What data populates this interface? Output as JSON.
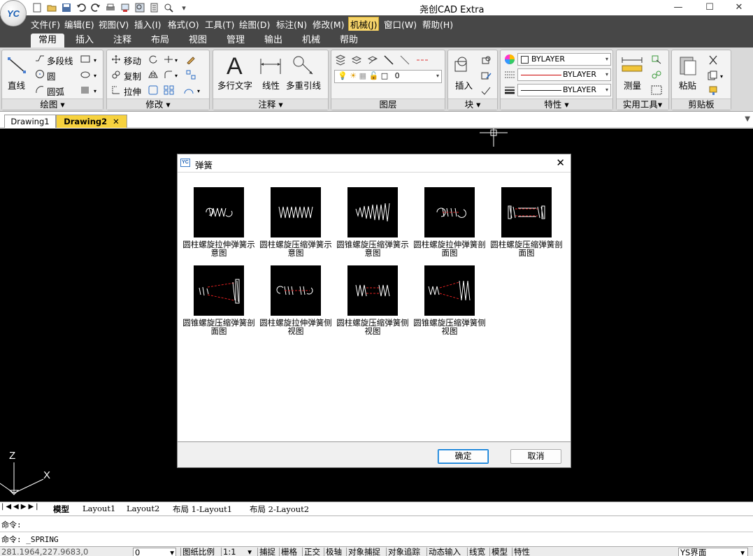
{
  "titlebar": {
    "logo_text": "YC",
    "app_title": "尧创CAD Extra",
    "qat_icons": [
      "new-icon",
      "open-icon",
      "save-icon",
      "undo-icon",
      "redo-icon",
      "print-icon",
      "plot-icon",
      "zoom-icon",
      "properties-icon",
      "find-icon",
      "customize-qat-icon"
    ],
    "window_controls": [
      "—",
      "☐",
      "✕"
    ]
  },
  "menubar": [
    {
      "label": "文件(F)"
    },
    {
      "label": "编辑(E)"
    },
    {
      "label": "视图(V)"
    },
    {
      "label": "插入(I)"
    },
    {
      "label": "格式(O)"
    },
    {
      "label": "工具(T)"
    },
    {
      "label": "绘图(D)"
    },
    {
      "label": "标注(N)"
    },
    {
      "label": "修改(M)"
    },
    {
      "label": "机械(J)"
    },
    {
      "label": "窗口(W)"
    },
    {
      "label": "帮助(H)"
    }
  ],
  "ribbon_tabs": [
    "常用",
    "插入",
    "注释",
    "布局",
    "视图",
    "管理",
    "输出",
    "机械",
    "帮助"
  ],
  "ribbon": {
    "draw": {
      "title": "绘图",
      "line": "直线",
      "polyline": "多段线",
      "circle": "圆",
      "arc": "圆弧"
    },
    "modify": {
      "title": "修改",
      "move": "移动",
      "copy": "复制",
      "stretch": "拉伸"
    },
    "annotate": {
      "title": "注释",
      "mtext": "多行文字",
      "linear": "线性",
      "mleader": "多重引线"
    },
    "layers": {
      "title": "图层",
      "current_layer": "0"
    },
    "block": {
      "title": "块",
      "insert": "插入"
    },
    "properties": {
      "title": "特性",
      "color": "BYLAYER",
      "linetype": "BYLAYER",
      "lineweight": "BYLAYER"
    },
    "utilities": {
      "title": "实用工具",
      "measure": "测量"
    },
    "clipboard": {
      "title": "剪贴板",
      "paste": "粘贴"
    }
  },
  "doc_tabs": [
    {
      "label": "Drawing1"
    },
    {
      "label": "Drawing2",
      "active": true
    }
  ],
  "dialog": {
    "title": "弹簧",
    "items": [
      {
        "label": "圆柱螺旋拉伸弹簧示意图"
      },
      {
        "label": "圆柱螺旋压缩弹簧示意图"
      },
      {
        "label": "圆锥螺旋压缩弹簧示意图"
      },
      {
        "label": "圆柱螺旋拉伸弹簧剖面图"
      },
      {
        "label": "圆柱螺旋压缩弹簧剖面图"
      },
      {
        "label": "圆锥螺旋压缩弹簧剖面图"
      },
      {
        "label": "圆柱螺旋拉伸弹簧侧视图"
      },
      {
        "label": "圆柱螺旋压缩弹簧侧视图"
      },
      {
        "label": "圆锥螺旋压缩弹簧侧视图"
      }
    ],
    "ok": "确定",
    "cancel": "取消"
  },
  "ucs": {
    "z": "Z",
    "x": "X"
  },
  "layout_tabs": [
    "模型",
    "Layout1",
    "Layout2",
    "布局 1-Layout1",
    "布局 2-Layout2"
  ],
  "command": {
    "line1": "命令:",
    "line2": "命令: _SPRING"
  },
  "status": {
    "coords": "281.1964,227.9683,0",
    "layer": "0",
    "paper_scale_label": "图纸比例",
    "scale": "1:1",
    "toggles": [
      "捕捉",
      "栅格",
      "正交",
      "极轴",
      "对象捕捉",
      "对象追踪",
      "动态输入",
      "线宽",
      "模型",
      "特性"
    ],
    "workspace": "YS界面"
  },
  "colors": {
    "menubar": "#474747",
    "canvas": "#000000",
    "active_doc_tab": "#f7d23e",
    "spring_red": "#e02020"
  }
}
